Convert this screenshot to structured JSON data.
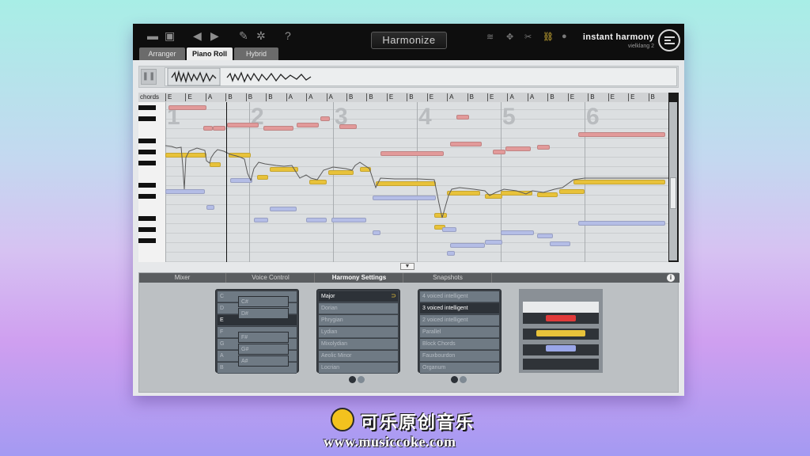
{
  "toolbar": {
    "harmonize_label": "Harmonize",
    "brand_title": "instant harmony",
    "brand_subtitle": "vielklang 2",
    "left_icons": [
      "folder-open-icon",
      "folder-save-icon",
      "undo-arrow-icon",
      "redo-arrow-icon",
      "edit-icon",
      "settings-gear-icon",
      "help-icon"
    ],
    "right_icons": [
      "waves-icon",
      "move-icon",
      "cut-icon",
      "link-icon",
      "record-icon"
    ],
    "accent_color": "#e8c23a"
  },
  "tabs": [
    {
      "label": "Arranger",
      "active": false
    },
    {
      "label": "Piano Roll",
      "active": true
    },
    {
      "label": "Hybrid",
      "active": false
    }
  ],
  "piano_roll": {
    "chords_label": "chords",
    "chords": [
      "E",
      "E",
      "A",
      "B",
      "B",
      "B",
      "A",
      "A",
      "A",
      "B",
      "B",
      "E",
      "B",
      "E",
      "A",
      "B",
      "E",
      "A",
      "A",
      "B",
      "E",
      "B",
      "E",
      "E",
      "B"
    ],
    "bar_numbers": [
      "1",
      "2",
      "3",
      "4",
      "5",
      "6"
    ]
  },
  "lower_tabs": [
    {
      "label": "Mixer",
      "active": false
    },
    {
      "label": "Voice Control",
      "active": false
    },
    {
      "label": "Harmony Settings",
      "active": true
    },
    {
      "label": "Snapshots",
      "active": false
    }
  ],
  "key_list": {
    "naturals": [
      "C",
      "D",
      "E",
      "F",
      "G",
      "A",
      "B"
    ],
    "selected": "E",
    "sharps_top": [
      "C#",
      "D#"
    ],
    "sharps_bottom": [
      "F#",
      "G#",
      "A#"
    ]
  },
  "scale_list": {
    "items": [
      "Major",
      "Dorian",
      "Phrygian",
      "Lydian",
      "Mixolydian",
      "Aeolic Minor",
      "Locrian"
    ],
    "selected": "Major"
  },
  "voicing_list": {
    "items": [
      "4 voiced intelligent",
      "3 voiced intelligent",
      "2 voiced intelligent",
      "Parallel",
      "Block Chords",
      "Fauxbourdon",
      "Organum"
    ],
    "selected": "3 voiced intelligent"
  },
  "voice_colors": {
    "top": "#f2f2f2",
    "red": "#e03a3a",
    "yellow": "#e8c23a",
    "blue": "#9aa6e8"
  },
  "footer": {
    "title": "可乐原创音乐",
    "url": "www.musiccoke.com"
  }
}
